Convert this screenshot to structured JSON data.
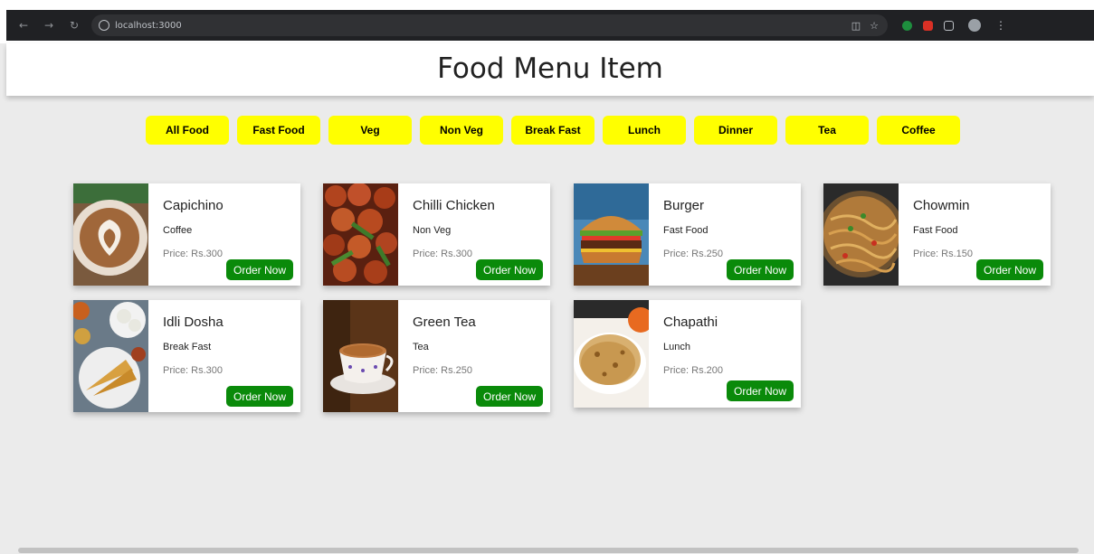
{
  "browser": {
    "url": "localhost:3000"
  },
  "header": {
    "title": "Food Menu Item"
  },
  "categories": [
    "All Food",
    "Fast Food",
    "Veg",
    "Non Veg",
    "Break Fast",
    "Lunch",
    "Dinner",
    "Tea",
    "Coffee"
  ],
  "items": [
    {
      "name": "Capichino",
      "category": "Coffee",
      "price": "Price: Rs.300",
      "button": "Order Now",
      "image": "coffee-latte-art-icon"
    },
    {
      "name": "Chilli Chicken",
      "category": "Non Veg",
      "price": "Price: Rs.300",
      "button": "Order Now",
      "image": "chilli-chicken-icon"
    },
    {
      "name": "Burger",
      "category": "Fast Food",
      "price": "Price: Rs.250",
      "button": "Order Now",
      "image": "burger-icon"
    },
    {
      "name": "Chowmin",
      "category": "Fast Food",
      "price": "Price: Rs.150",
      "button": "Order Now",
      "image": "noodles-icon"
    },
    {
      "name": "Idli Dosha",
      "category": "Break Fast",
      "price": "Price: Rs.300",
      "button": "Order Now",
      "image": "dosa-icon"
    },
    {
      "name": "Green Tea",
      "category": "Tea",
      "price": "Price: Rs.250",
      "button": "Order Now",
      "image": "tea-cup-icon"
    },
    {
      "name": "Chapathi",
      "category": "Lunch",
      "price": "Price: Rs.200",
      "button": "Order Now",
      "image": "chapathi-icon"
    }
  ],
  "colors": {
    "category_button": "#ffff00",
    "order_button": "#0a8a0a",
    "page_bg": "#ebebeb"
  }
}
